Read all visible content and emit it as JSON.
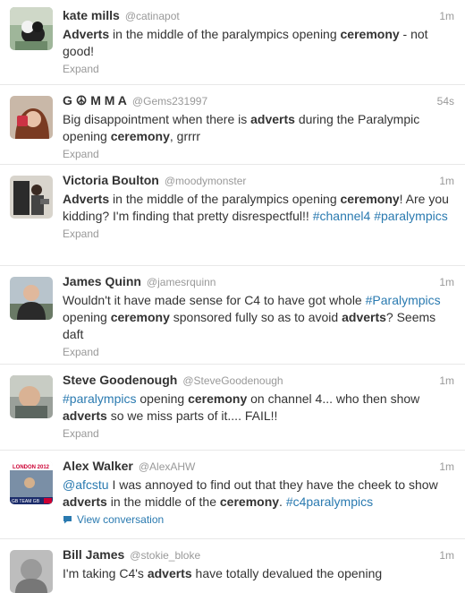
{
  "tweets": [
    {
      "fullname": "kate mills",
      "username": "@catinapot",
      "time": "1m",
      "text": [
        "Adverts",
        " in the middle of the paralympics opening ",
        "ceremony",
        " - not good!"
      ],
      "action": "Expand"
    },
    {
      "fullname": "G ☮ M M A",
      "username": "@Gems231997",
      "time": "54s",
      "text": [
        "Big disappointment when there is ",
        "adverts",
        " during the Paralympic opening ",
        "ceremony",
        ", grrrr"
      ],
      "action": "Expand"
    },
    {
      "fullname": "Victoria Boulton",
      "username": "@moodymonster",
      "time": "1m",
      "text": [
        "Adverts",
        " in the middle of the paralympics opening ",
        "ceremony",
        "! Are you kidding? I'm finding that pretty disrespectful!! ",
        "#channel4",
        " ",
        "#paralympics"
      ],
      "action": "Expand"
    },
    {
      "fullname": "James Quinn",
      "username": "@jamesrquinn",
      "time": "1m",
      "text": [
        "Wouldn't it have made sense for C4 to have got whole ",
        "#Paralympics",
        " opening ",
        "ceremony",
        " sponsored fully so as to avoid ",
        "adverts",
        "? Seems daft"
      ],
      "action": "Expand"
    },
    {
      "fullname": "Steve Goodenough",
      "username": "@SteveGoodenough",
      "time": "1m",
      "text": [
        "#paralympics",
        " opening ",
        "ceremony",
        " on channel 4... who then show ",
        "adverts",
        " so we miss parts of it.... FAIL!!"
      ],
      "action": "Expand"
    },
    {
      "fullname": "Alex Walker",
      "username": "@AlexAHW",
      "time": "1m",
      "text": [
        "@afcstu",
        " I was annoyed to find out that they have the cheek to show ",
        "adverts",
        " in the middle of the ",
        "ceremony",
        ". ",
        "#c4paralympics"
      ],
      "action": "View conversation"
    },
    {
      "fullname": "Bill James",
      "username": "@stokie_bloke",
      "time": "1m",
      "text": [
        "I'm taking C4's ",
        "adverts",
        " have totally devalued the opening"
      ],
      "action": ""
    }
  ],
  "avatar_text": {
    "london": "LONDON 2012",
    "team": "GB TEAM GB"
  },
  "colors": {
    "link": "#2a7ab0",
    "muted": "#999999",
    "text": "#333333",
    "divider": "#e8e8e8"
  }
}
